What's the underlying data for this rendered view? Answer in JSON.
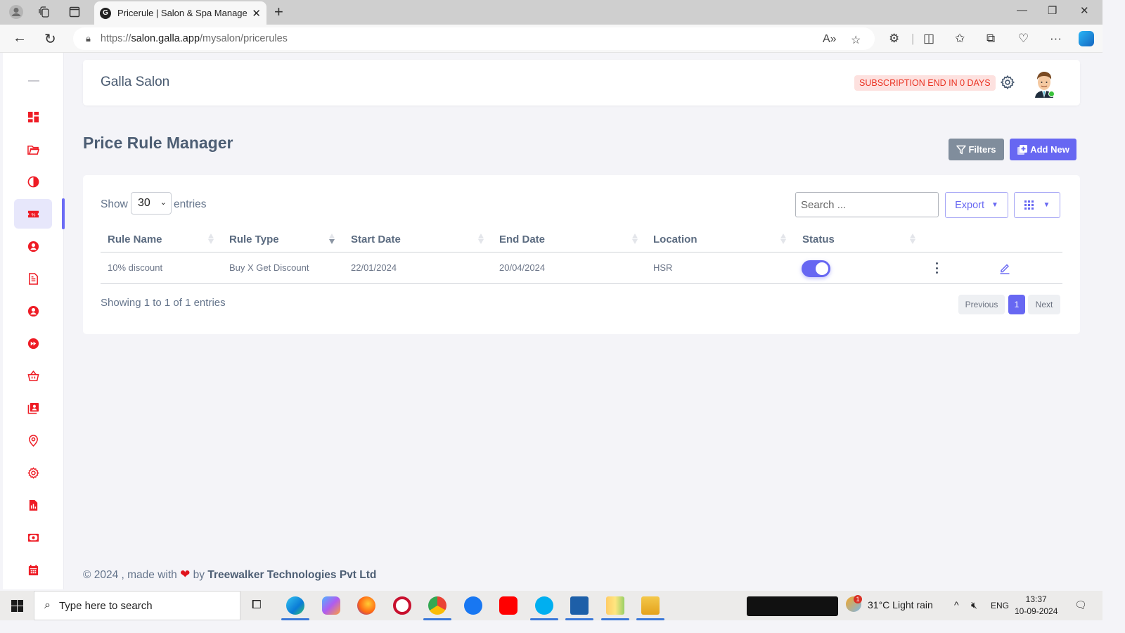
{
  "browser": {
    "tab_title": "Pricerule | Salon & Spa Managem",
    "tab_close": "✕",
    "new_tab": "+",
    "url_prefix": "https://",
    "url_host": "salon.galla.app",
    "url_path": "/mysalon/pricerules",
    "window": {
      "minimize": "—",
      "restore": "❐",
      "close": "✕"
    }
  },
  "header": {
    "salon_name": "Galla Salon",
    "subscription_badge": "SUBSCRIPTION END IN 0 DAYS",
    "badge_bg": "#fde1df",
    "badge_color": "#ea3424"
  },
  "sidebar": {
    "items": [
      {
        "icon": "dashboard-icon"
      },
      {
        "icon": "folder-open-icon"
      },
      {
        "icon": "contrast-icon"
      },
      {
        "icon": "discount-ticket-icon",
        "active": true
      },
      {
        "icon": "user-circle-icon"
      },
      {
        "icon": "document-icon"
      },
      {
        "icon": "user-circle-icon"
      },
      {
        "icon": "fast-forward-icon"
      },
      {
        "icon": "basket-icon"
      },
      {
        "icon": "contacts-icon"
      },
      {
        "icon": "location-pin-icon"
      },
      {
        "icon": "settings-gear-icon"
      },
      {
        "icon": "report-icon"
      },
      {
        "icon": "cash-icon"
      },
      {
        "icon": "calendar-icon"
      }
    ]
  },
  "page": {
    "title": "Price Rule Manager",
    "filters_label": "Filters",
    "add_new_label": "Add New",
    "accent": "#6767f2"
  },
  "table": {
    "show_label": "Show",
    "page_size": "30",
    "entries_label": "entries",
    "search_placeholder": "Search ...",
    "export_label": "Export",
    "columns": [
      "Rule Name",
      "Rule Type",
      "Start Date",
      "End Date",
      "Location",
      "Status"
    ],
    "rows": [
      {
        "rule_name": "10% discount",
        "rule_type": "Buy X Get Discount",
        "start_date": "22/01/2024",
        "end_date": "20/04/2024",
        "location": "HSR",
        "status_enabled": true
      }
    ],
    "info": "Showing 1 to 1 of 1 entries",
    "pagination": {
      "previous": "Previous",
      "current": "1",
      "next": "Next"
    }
  },
  "footer": {
    "prefix": "© 2024 , made with",
    "heart": "❤",
    "by": "by",
    "company": "Treewalker Technologies Pvt Ltd"
  },
  "taskbar": {
    "search_placeholder": "Type here to search",
    "weather": "31°C  Light rain",
    "weather_badge": "1",
    "language": "ENG",
    "time": "13:37",
    "date": "10-09-2024"
  }
}
